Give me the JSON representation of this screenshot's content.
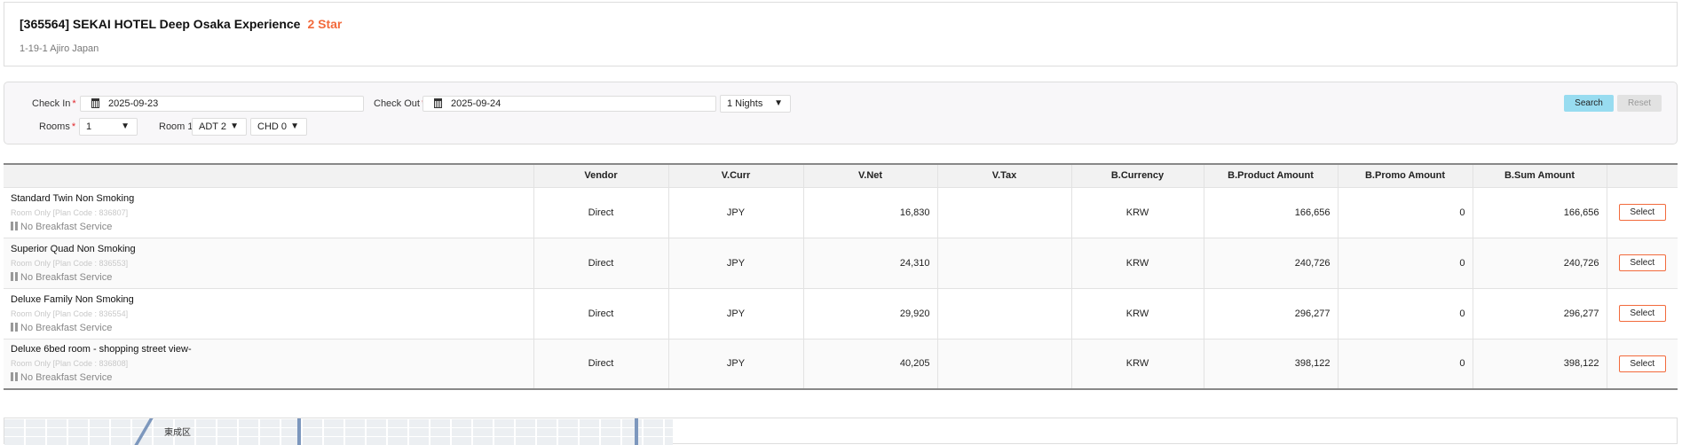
{
  "hotel": {
    "title": "[365564] SEKAI HOTEL Deep Osaka Experience",
    "star": "2 Star",
    "address": "1-19-1 Ajiro Japan"
  },
  "search": {
    "check_in_label": "Check In",
    "check_in": "2025-09-23",
    "check_out_label": "Check Out",
    "check_out": "2025-09-24",
    "nights": "1 Nights",
    "rooms_label": "Rooms",
    "rooms": "1",
    "room1_label": "Room 1",
    "adults": "ADT 2",
    "children": "CHD 0",
    "required_mark": "*",
    "search_label": "Search",
    "reset_label": "Reset",
    "dropdown_arrow": "▼"
  },
  "table": {
    "headers": [
      "",
      "Vendor",
      "V.Curr",
      "V.Net",
      "V.Tax",
      "B.Currency",
      "B.Product Amount",
      "B.Promo Amount",
      "B.Sum Amount",
      ""
    ],
    "select_label": "Select",
    "rows": [
      {
        "name": "Standard Twin Non Smoking",
        "plan": "Room Only [Plan Code : 836807]",
        "breakfast": "No Breakfast Service",
        "vendor": "Direct",
        "vcurr": "JPY",
        "vnet": "16,830",
        "vtax": "",
        "bcurr": "KRW",
        "bproduct": "166,656",
        "bpromo": "0",
        "bsum": "166,656"
      },
      {
        "name": "Superior Quad Non Smoking",
        "plan": "Room Only [Plan Code : 836553]",
        "breakfast": "No Breakfast Service",
        "vendor": "Direct",
        "vcurr": "JPY",
        "vnet": "24,310",
        "vtax": "",
        "bcurr": "KRW",
        "bproduct": "240,726",
        "bpromo": "0",
        "bsum": "240,726"
      },
      {
        "name": "Deluxe Family Non Smoking",
        "plan": "Room Only [Plan Code : 836554]",
        "breakfast": "No Breakfast Service",
        "vendor": "Direct",
        "vcurr": "JPY",
        "vnet": "29,920",
        "vtax": "",
        "bcurr": "KRW",
        "bproduct": "296,277",
        "bpromo": "0",
        "bsum": "296,277"
      },
      {
        "name": "Deluxe 6bed room - shopping street view-",
        "plan": "Room Only [Plan Code : 836808]",
        "breakfast": "No Breakfast Service",
        "vendor": "Direct",
        "vcurr": "JPY",
        "vnet": "40,205",
        "vtax": "",
        "bcurr": "KRW",
        "bproduct": "398,122",
        "bpromo": "0",
        "bsum": "398,122"
      }
    ]
  },
  "map": {
    "district_label": "東成区"
  },
  "colors": {
    "accent": "#f26a3c",
    "search_button": "#98dcf0",
    "reset_button": "#e2e2e2"
  }
}
